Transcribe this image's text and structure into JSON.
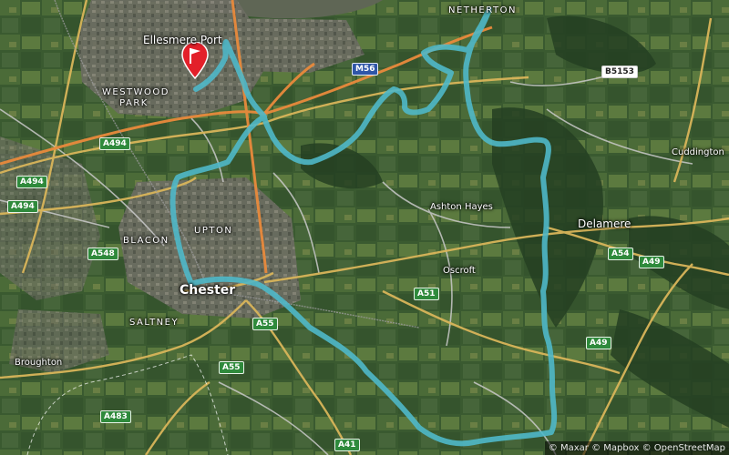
{
  "map": {
    "colors": {
      "route": "#4fb8c9",
      "motorway": "#e98a3c",
      "primary_road": "#d9b55a",
      "minor_road": "#c9c9c9",
      "marker": "#e3202a",
      "water": "#5f6655"
    },
    "places": [
      {
        "name": "Ellesmere Port",
        "kind": "town"
      },
      {
        "name": "WESTWOOD\nPARK",
        "kind": "caps"
      },
      {
        "name": "NETHERTON",
        "kind": "caps"
      },
      {
        "name": "UPTON",
        "kind": "caps"
      },
      {
        "name": "BLACON",
        "kind": "caps"
      },
      {
        "name": "Chester",
        "kind": "city"
      },
      {
        "name": "SALTNEY",
        "kind": "caps"
      },
      {
        "name": "Broughton",
        "kind": "small"
      },
      {
        "name": "Ashton Hayes",
        "kind": "small"
      },
      {
        "name": "Oscroft",
        "kind": "small"
      },
      {
        "name": "Delamere",
        "kind": "town"
      },
      {
        "name": "Cuddington",
        "kind": "small"
      }
    ],
    "road_shields": [
      {
        "label": "M56",
        "style": "blue"
      },
      {
        "label": "B5153",
        "style": "white"
      },
      {
        "label": "A494",
        "style": "green"
      },
      {
        "label": "A494",
        "style": "green"
      },
      {
        "label": "A494",
        "style": "green"
      },
      {
        "label": "A548",
        "style": "green"
      },
      {
        "label": "A55",
        "style": "green"
      },
      {
        "label": "A51",
        "style": "green"
      },
      {
        "label": "A55",
        "style": "green"
      },
      {
        "label": "A54",
        "style": "green"
      },
      {
        "label": "A49",
        "style": "green"
      },
      {
        "label": "A49",
        "style": "green"
      },
      {
        "label": "A483",
        "style": "green"
      },
      {
        "label": "A41",
        "style": "green"
      }
    ],
    "attribution": "© Maxar © Mapbox © OpenStreetMap",
    "marker_icon": "start-flag-icon"
  }
}
